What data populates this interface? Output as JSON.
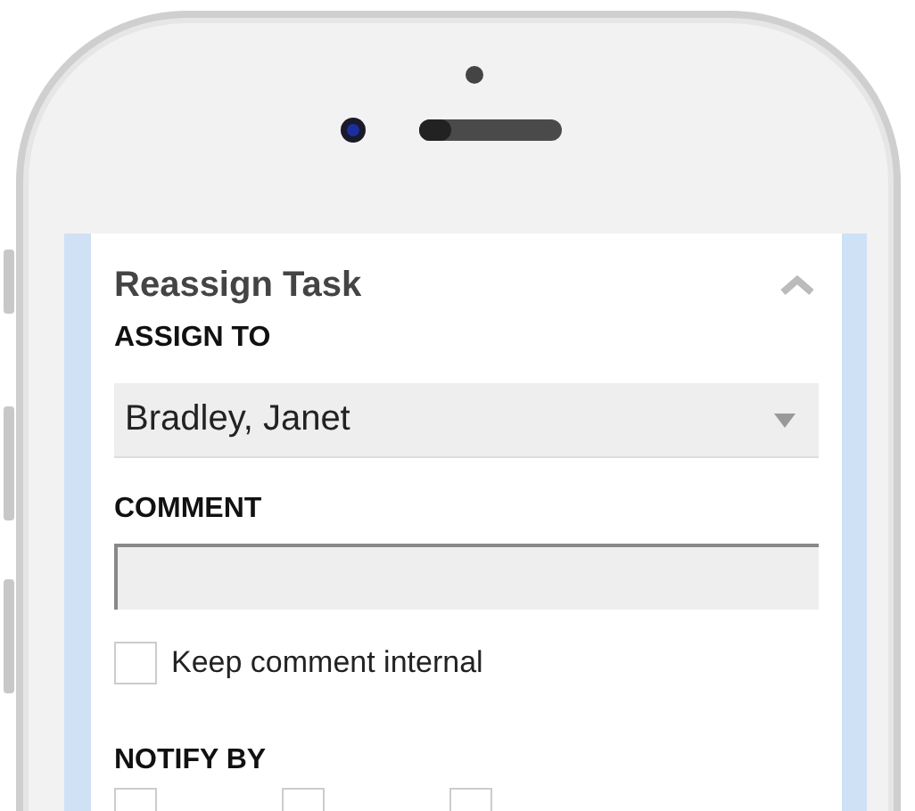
{
  "panel": {
    "title": "Reassign Task",
    "expanded": true
  },
  "assign_to": {
    "label": "ASSIGN TO",
    "value": "Bradley, Janet"
  },
  "comment": {
    "label": "COMMENT"
  },
  "keep_internal": {
    "label": "Keep comment internal",
    "checked": false
  },
  "notify_by": {
    "label": "NOTIFY BY",
    "options": [
      {
        "checked": false
      },
      {
        "checked": false
      },
      {
        "checked": false
      }
    ]
  }
}
